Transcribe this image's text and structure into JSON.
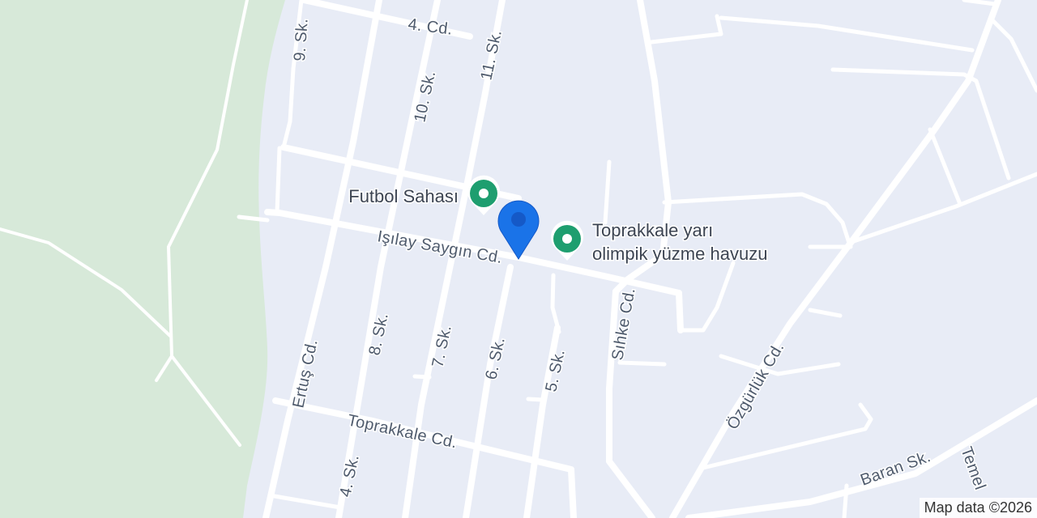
{
  "map": {
    "streets": {
      "s_4_cd": "4. Cd.",
      "s_9_sk": "9. Sk.",
      "s_10_sk": "10. Sk.",
      "s_11_sk": "11. Sk.",
      "s_islay": "Işılay Saygın Cd.",
      "s_ertus": "Ertuş Cd.",
      "s_8_sk": "8. Sk.",
      "s_7_sk": "7. Sk.",
      "s_6_sk": "6. Sk.",
      "s_5_sk": "5. Sk.",
      "s_sihke": "Sıhke Cd.",
      "s_ozgurluk": "Özgürlük Cd.",
      "s_toprakkale": "Toprakkale Cd.",
      "s_4_sk": "4. Sk.",
      "s_baran": "Baran Sk.",
      "s_temel": "Temel"
    },
    "pois": {
      "futbol_name": "Futbol Sahası",
      "havuz_line1": "Toprakkale yarı",
      "havuz_line2": "olimpik yüzme havuzu"
    },
    "attribution": "Map data ©2026",
    "colors": {
      "background": "#e8ecf6",
      "park": "#d7e9d9",
      "road": "#ffffff",
      "poi_marker": "#1e9e6f",
      "location_pin": "#1a73e8"
    },
    "icons": {
      "poi": "poi-pin-icon",
      "location": "location-pin-icon"
    }
  }
}
